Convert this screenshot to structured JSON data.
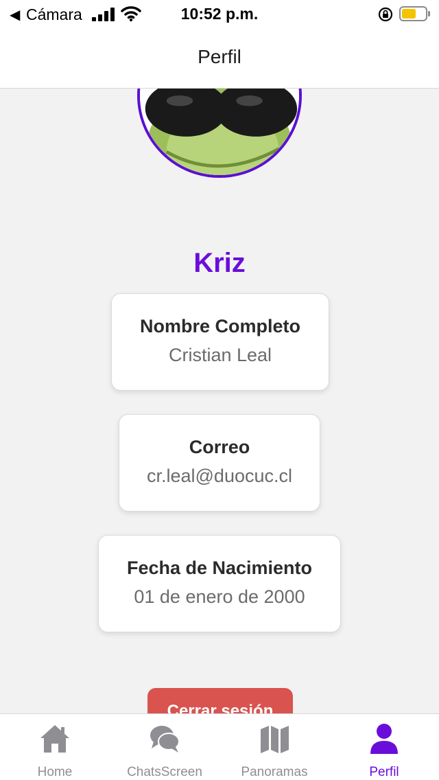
{
  "status_bar": {
    "back_app": "Cámara",
    "time": "10:52 p.m."
  },
  "header": {
    "title": "Perfil"
  },
  "profile": {
    "username": "Kriz",
    "fields": [
      {
        "label": "Nombre Completo",
        "value": "Cristian Leal"
      },
      {
        "label": "Correo",
        "value": "cr.leal@duocuc.cl"
      },
      {
        "label": "Fecha de Nacimiento",
        "value": "01 de enero de 2000"
      }
    ],
    "logout_label": "Cerrar sesión"
  },
  "tabs": [
    {
      "label": "Home",
      "icon": "home-icon"
    },
    {
      "label": "ChatsScreen",
      "icon": "chat-icon"
    },
    {
      "label": "Panoramas",
      "icon": "map-icon"
    },
    {
      "label": "Perfil",
      "icon": "user-icon",
      "active": true
    }
  ],
  "colors": {
    "accent": "#6a0ddb",
    "logout": "#d9534f",
    "inactive_tab": "#8e8e93",
    "battery": "#f5c400"
  }
}
